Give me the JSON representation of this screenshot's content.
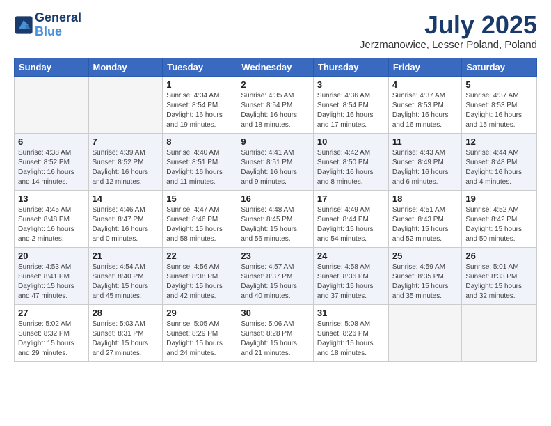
{
  "logo": {
    "line1": "General",
    "line2": "Blue"
  },
  "title": "July 2025",
  "subtitle": "Jerzmanowice, Lesser Poland, Poland",
  "headers": [
    "Sunday",
    "Monday",
    "Tuesday",
    "Wednesday",
    "Thursday",
    "Friday",
    "Saturday"
  ],
  "weeks": [
    [
      {
        "day": "",
        "info": ""
      },
      {
        "day": "",
        "info": ""
      },
      {
        "day": "1",
        "info": "Sunrise: 4:34 AM\nSunset: 8:54 PM\nDaylight: 16 hours and 19 minutes."
      },
      {
        "day": "2",
        "info": "Sunrise: 4:35 AM\nSunset: 8:54 PM\nDaylight: 16 hours and 18 minutes."
      },
      {
        "day": "3",
        "info": "Sunrise: 4:36 AM\nSunset: 8:54 PM\nDaylight: 16 hours and 17 minutes."
      },
      {
        "day": "4",
        "info": "Sunrise: 4:37 AM\nSunset: 8:53 PM\nDaylight: 16 hours and 16 minutes."
      },
      {
        "day": "5",
        "info": "Sunrise: 4:37 AM\nSunset: 8:53 PM\nDaylight: 16 hours and 15 minutes."
      }
    ],
    [
      {
        "day": "6",
        "info": "Sunrise: 4:38 AM\nSunset: 8:52 PM\nDaylight: 16 hours and 14 minutes."
      },
      {
        "day": "7",
        "info": "Sunrise: 4:39 AM\nSunset: 8:52 PM\nDaylight: 16 hours and 12 minutes."
      },
      {
        "day": "8",
        "info": "Sunrise: 4:40 AM\nSunset: 8:51 PM\nDaylight: 16 hours and 11 minutes."
      },
      {
        "day": "9",
        "info": "Sunrise: 4:41 AM\nSunset: 8:51 PM\nDaylight: 16 hours and 9 minutes."
      },
      {
        "day": "10",
        "info": "Sunrise: 4:42 AM\nSunset: 8:50 PM\nDaylight: 16 hours and 8 minutes."
      },
      {
        "day": "11",
        "info": "Sunrise: 4:43 AM\nSunset: 8:49 PM\nDaylight: 16 hours and 6 minutes."
      },
      {
        "day": "12",
        "info": "Sunrise: 4:44 AM\nSunset: 8:48 PM\nDaylight: 16 hours and 4 minutes."
      }
    ],
    [
      {
        "day": "13",
        "info": "Sunrise: 4:45 AM\nSunset: 8:48 PM\nDaylight: 16 hours and 2 minutes."
      },
      {
        "day": "14",
        "info": "Sunrise: 4:46 AM\nSunset: 8:47 PM\nDaylight: 16 hours and 0 minutes."
      },
      {
        "day": "15",
        "info": "Sunrise: 4:47 AM\nSunset: 8:46 PM\nDaylight: 15 hours and 58 minutes."
      },
      {
        "day": "16",
        "info": "Sunrise: 4:48 AM\nSunset: 8:45 PM\nDaylight: 15 hours and 56 minutes."
      },
      {
        "day": "17",
        "info": "Sunrise: 4:49 AM\nSunset: 8:44 PM\nDaylight: 15 hours and 54 minutes."
      },
      {
        "day": "18",
        "info": "Sunrise: 4:51 AM\nSunset: 8:43 PM\nDaylight: 15 hours and 52 minutes."
      },
      {
        "day": "19",
        "info": "Sunrise: 4:52 AM\nSunset: 8:42 PM\nDaylight: 15 hours and 50 minutes."
      }
    ],
    [
      {
        "day": "20",
        "info": "Sunrise: 4:53 AM\nSunset: 8:41 PM\nDaylight: 15 hours and 47 minutes."
      },
      {
        "day": "21",
        "info": "Sunrise: 4:54 AM\nSunset: 8:40 PM\nDaylight: 15 hours and 45 minutes."
      },
      {
        "day": "22",
        "info": "Sunrise: 4:56 AM\nSunset: 8:38 PM\nDaylight: 15 hours and 42 minutes."
      },
      {
        "day": "23",
        "info": "Sunrise: 4:57 AM\nSunset: 8:37 PM\nDaylight: 15 hours and 40 minutes."
      },
      {
        "day": "24",
        "info": "Sunrise: 4:58 AM\nSunset: 8:36 PM\nDaylight: 15 hours and 37 minutes."
      },
      {
        "day": "25",
        "info": "Sunrise: 4:59 AM\nSunset: 8:35 PM\nDaylight: 15 hours and 35 minutes."
      },
      {
        "day": "26",
        "info": "Sunrise: 5:01 AM\nSunset: 8:33 PM\nDaylight: 15 hours and 32 minutes."
      }
    ],
    [
      {
        "day": "27",
        "info": "Sunrise: 5:02 AM\nSunset: 8:32 PM\nDaylight: 15 hours and 29 minutes."
      },
      {
        "day": "28",
        "info": "Sunrise: 5:03 AM\nSunset: 8:31 PM\nDaylight: 15 hours and 27 minutes."
      },
      {
        "day": "29",
        "info": "Sunrise: 5:05 AM\nSunset: 8:29 PM\nDaylight: 15 hours and 24 minutes."
      },
      {
        "day": "30",
        "info": "Sunrise: 5:06 AM\nSunset: 8:28 PM\nDaylight: 15 hours and 21 minutes."
      },
      {
        "day": "31",
        "info": "Sunrise: 5:08 AM\nSunset: 8:26 PM\nDaylight: 15 hours and 18 minutes."
      },
      {
        "day": "",
        "info": ""
      },
      {
        "day": "",
        "info": ""
      }
    ]
  ]
}
